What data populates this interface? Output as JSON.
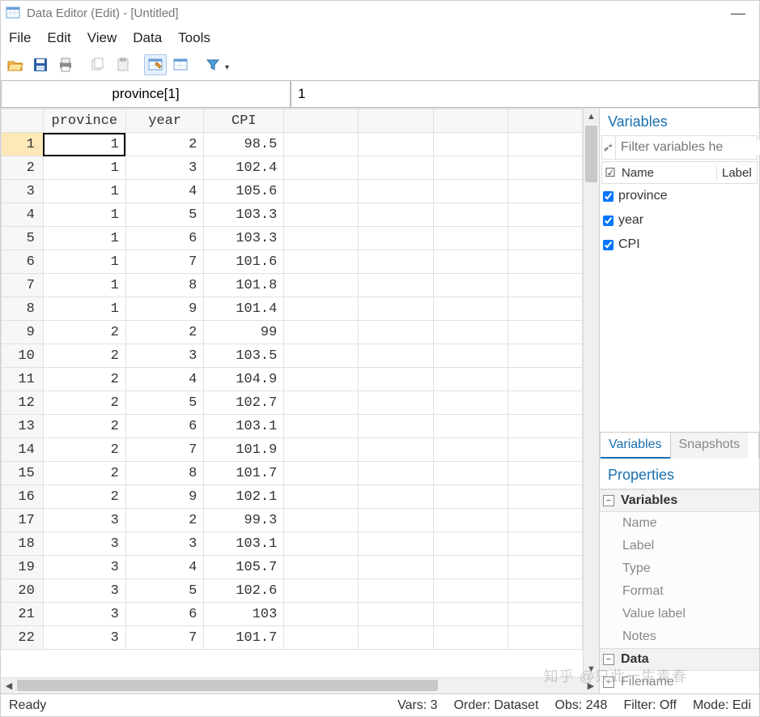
{
  "window": {
    "title": "Data Editor (Edit) - [Untitled]"
  },
  "menu": [
    "File",
    "Edit",
    "View",
    "Data",
    "Tools"
  ],
  "toolbar_icons": [
    "open-icon",
    "save-icon",
    "print-icon",
    "copy-icon",
    "paste-icon",
    "data-editor-icon",
    "browse-icon",
    "filter-icon"
  ],
  "address": {
    "cell": "province[1]",
    "value": "1"
  },
  "columns": [
    "province",
    "year",
    "CPI"
  ],
  "rows": [
    {
      "n": 1,
      "province": 1,
      "year": 2,
      "CPI": "98.5"
    },
    {
      "n": 2,
      "province": 1,
      "year": 3,
      "CPI": "102.4"
    },
    {
      "n": 3,
      "province": 1,
      "year": 4,
      "CPI": "105.6"
    },
    {
      "n": 4,
      "province": 1,
      "year": 5,
      "CPI": "103.3"
    },
    {
      "n": 5,
      "province": 1,
      "year": 6,
      "CPI": "103.3"
    },
    {
      "n": 6,
      "province": 1,
      "year": 7,
      "CPI": "101.6"
    },
    {
      "n": 7,
      "province": 1,
      "year": 8,
      "CPI": "101.8"
    },
    {
      "n": 8,
      "province": 1,
      "year": 9,
      "CPI": "101.4"
    },
    {
      "n": 9,
      "province": 2,
      "year": 2,
      "CPI": "99"
    },
    {
      "n": 10,
      "province": 2,
      "year": 3,
      "CPI": "103.5"
    },
    {
      "n": 11,
      "province": 2,
      "year": 4,
      "CPI": "104.9"
    },
    {
      "n": 12,
      "province": 2,
      "year": 5,
      "CPI": "102.7"
    },
    {
      "n": 13,
      "province": 2,
      "year": 6,
      "CPI": "103.1"
    },
    {
      "n": 14,
      "province": 2,
      "year": 7,
      "CPI": "101.9"
    },
    {
      "n": 15,
      "province": 2,
      "year": 8,
      "CPI": "101.7"
    },
    {
      "n": 16,
      "province": 2,
      "year": 9,
      "CPI": "102.1"
    },
    {
      "n": 17,
      "province": 3,
      "year": 2,
      "CPI": "99.3"
    },
    {
      "n": 18,
      "province": 3,
      "year": 3,
      "CPI": "103.1"
    },
    {
      "n": 19,
      "province": 3,
      "year": 4,
      "CPI": "105.7"
    },
    {
      "n": 20,
      "province": 3,
      "year": 5,
      "CPI": "102.6"
    },
    {
      "n": 21,
      "province": 3,
      "year": 6,
      "CPI": "103"
    },
    {
      "n": 22,
      "province": 3,
      "year": 7,
      "CPI": "101.7"
    }
  ],
  "side": {
    "variables_title": "Variables",
    "filter_placeholder": "Filter variables he",
    "var_header": {
      "name": "Name",
      "label": "Label"
    },
    "var_list": [
      "province",
      "year",
      "CPI"
    ],
    "tabs": {
      "variables": "Variables",
      "snapshots": "Snapshots"
    },
    "properties_title": "Properties",
    "groups": {
      "variables": {
        "title": "Variables",
        "items": [
          "Name",
          "Label",
          "Type",
          "Format",
          "Value label",
          "Notes"
        ]
      },
      "data": {
        "title": "Data",
        "items": [
          "Filename"
        ]
      }
    }
  },
  "status": {
    "ready": "Ready",
    "vars": "Vars: 3",
    "order": "Order: Dataset",
    "obs": "Obs: 248",
    "filter": "Filter: Off",
    "mode": "Mode: Edi"
  },
  "watermark": "知乎 @只此一生青春"
}
